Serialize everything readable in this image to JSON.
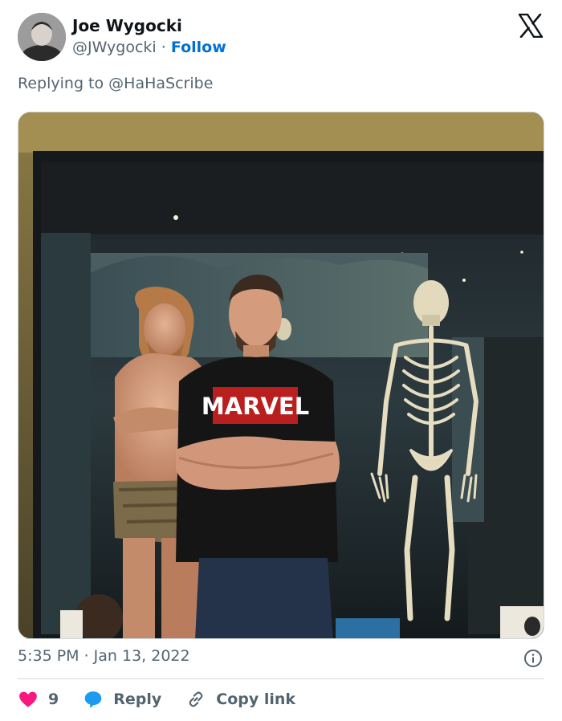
{
  "author": {
    "name": "Joe Wygocki",
    "handle": "@JWygocki",
    "separator": "·",
    "follow_label": "Follow"
  },
  "reply_context": {
    "prefix": "Replying to",
    "mention": "@HaHaScribe"
  },
  "media": {
    "shirt_text": "MARVEL"
  },
  "timestamp": "5:35 PM · Jan 13, 2022",
  "actions": {
    "like_count": "9",
    "reply_label": "Reply",
    "copy_link_label": "Copy link"
  },
  "colors": {
    "accent": "#006fd6",
    "like": "#f91880",
    "reply": "#1d9bf0",
    "muted": "#536471"
  }
}
